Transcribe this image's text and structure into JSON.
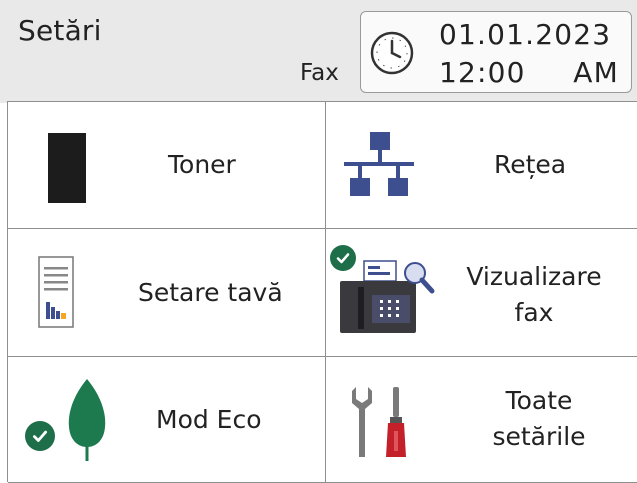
{
  "header": {
    "title": "Setări",
    "mode_label": "Fax",
    "date": "01.01.2023",
    "time": "12:00",
    "ampm": "AM"
  },
  "tiles": {
    "toner": {
      "label": "Toner",
      "icon": "toner-cartridge-icon"
    },
    "network": {
      "label": "Rețea",
      "icon": "network-icon"
    },
    "tray": {
      "label": "Setare tavă",
      "icon": "tray-settings-icon"
    },
    "fax_preview": {
      "line1": "Vizualizare",
      "line2": "fax",
      "icon": "fax-preview-icon"
    },
    "eco": {
      "label": "Mod Eco",
      "icon": "eco-leaf-icon"
    },
    "all_settings": {
      "line1": "Toate",
      "line2": "setările",
      "icon": "tools-icon"
    }
  },
  "colors": {
    "header_bg": "#e9e9e9",
    "network_blue": "#3d4f8f",
    "check_green": "#1f6e4a",
    "leaf_green": "#1c7a4e",
    "tool_red": "#c3202a",
    "tray_orange": "#f5a623"
  }
}
